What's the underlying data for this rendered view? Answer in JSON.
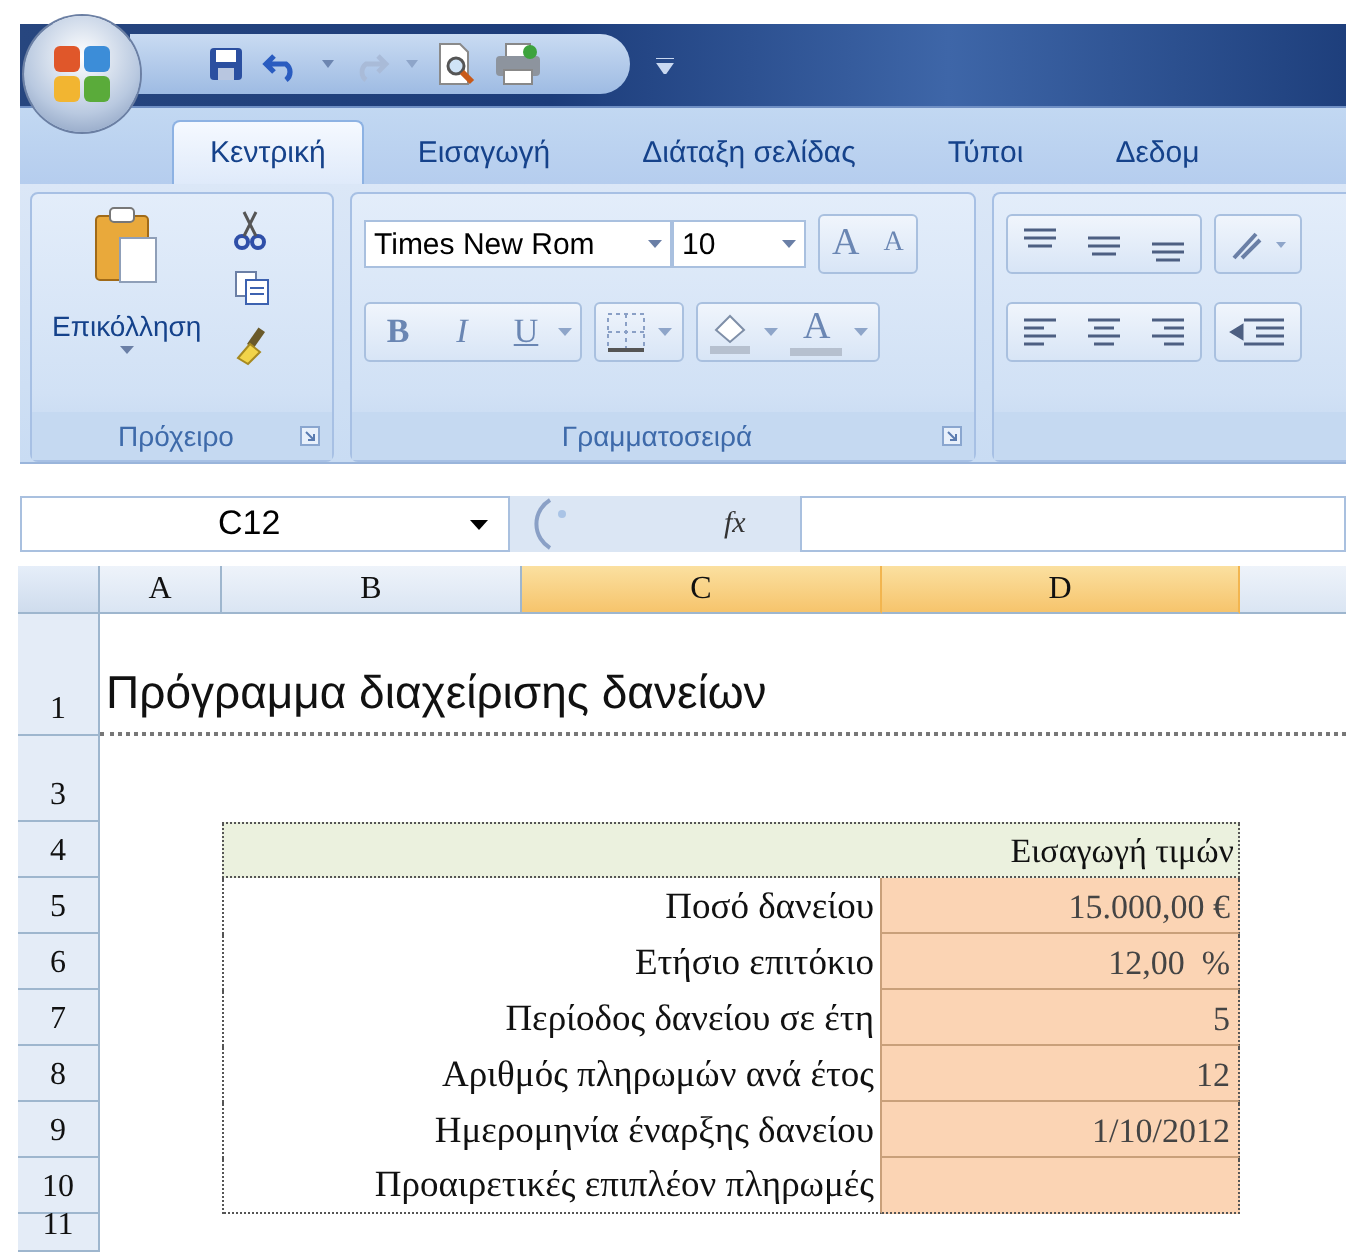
{
  "tabs": [
    {
      "label": "Κεντρική",
      "selected": true
    },
    {
      "label": "Εισαγωγή",
      "selected": false
    },
    {
      "label": "Διάταξη σελίδας",
      "selected": false
    },
    {
      "label": "Τύποι",
      "selected": false
    },
    {
      "label": "Δεδομ",
      "selected": false
    }
  ],
  "ribbon": {
    "clipboard": {
      "paste_label": "Επικόλληση",
      "group_label": "Πρόχειρο"
    },
    "font": {
      "font_name": "Times New Rom",
      "font_size": "10",
      "grow_label": "A",
      "shrink_label": "A",
      "format_buttons": [
        {
          "label": "B",
          "kind": "bold"
        },
        {
          "label": "I",
          "kind": "italic"
        },
        {
          "label": "U",
          "kind": "underline"
        }
      ],
      "font_color_label": "A",
      "group_label": "Γραμματοσειρά"
    }
  },
  "formula_bar": {
    "name_box": "C12",
    "function_label": "fx"
  },
  "sheet": {
    "columns": [
      {
        "label": "A",
        "selected": false
      },
      {
        "label": "B",
        "selected": false
      },
      {
        "label": "C",
        "selected": true
      },
      {
        "label": "D",
        "selected": true
      }
    ],
    "row_numbers": [
      "1",
      "3",
      "4",
      "5",
      "6",
      "7",
      "8",
      "9",
      "10",
      "11"
    ],
    "title": "Πρόγραμμα διαχείρισης δανείων",
    "input_header": "Εισαγωγή τιμών",
    "inputs": [
      {
        "label": "Ποσό δανείου",
        "value": "15.000,00 €"
      },
      {
        "label": "Ετήσιο επιτόκιο",
        "value": "12,00  %"
      },
      {
        "label": "Περίοδος δανείου σε έτη",
        "value": "5"
      },
      {
        "label": "Αριθμός πληρωμών ανά έτος",
        "value": "12"
      },
      {
        "label": "Ημερομηνία έναρξης δανείου",
        "value": "1/10/2012"
      },
      {
        "label": "Προαιρετικές επιπλέον πληρωμές"
      }
    ]
  }
}
